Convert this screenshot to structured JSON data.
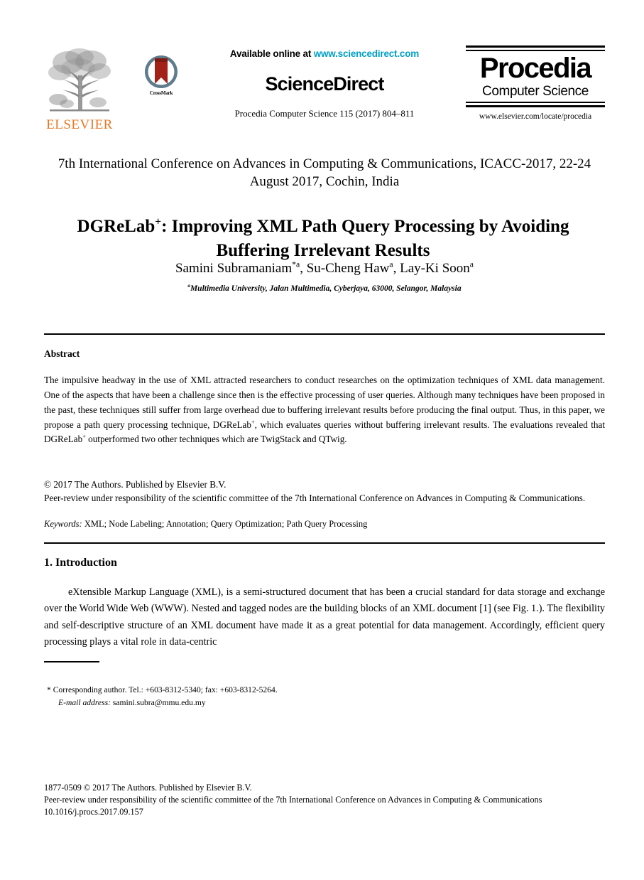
{
  "masthead": {
    "elsevier": {
      "wordmark": "ELSEVIER",
      "logo_icon": "elsevier-tree-icon",
      "wordmark_color": "#E87722"
    },
    "crossmark": {
      "label": "CrossMark",
      "icon": "crossmark-badge-icon",
      "ring_color": "#5E7C8C",
      "ribbon_color": "#A32217"
    },
    "sciencedirect": {
      "available_prefix": "Available online at ",
      "url": "www.sciencedirect.com",
      "url_color": "#009FC7",
      "wordmark": "ScienceDirect",
      "series_line": "Procedia Computer Science 115 (2017) 804–811"
    },
    "procedia": {
      "name": "Procedia",
      "subtitle": "Computer Science",
      "url": "www.elsevier.com/locate/procedia"
    }
  },
  "conference": "7th International Conference on Advances in Computing & Communications, ICACC-2017, 22-24 August 2017, Cochin, India",
  "title": {
    "part1": "DGReLab",
    "superscript": "+",
    "part2": ": Improving XML Path Query Processing by Avoiding Buffering Irrelevant Results"
  },
  "authors": {
    "author1_name": "Samini Subramaniam",
    "author1_marks": "*a",
    "author2_name": "Su-Cheng Haw",
    "author2_marks": "a",
    "author3_name": "Lay-Ki Soon",
    "author3_marks": "a",
    "separator": ", "
  },
  "affiliation": {
    "mark": "a",
    "text": "Multimedia University, Jalan Multimedia, Cyberjaya, 63000, Selangor, Malaysia"
  },
  "abstract": {
    "heading": "Abstract",
    "paragraph_before_sup": "The impulsive headway in the use of XML attracted researchers to conduct researches on the optimization techniques of XML data management. One of the aspects that have been a challenge since then is the effective processing of user queries. Although many techniques have been proposed in the past, these techniques still suffer from large overhead due to buffering irrelevant results before producing the final output.  Thus, in this paper, we propose a path query processing technique, DGReLab",
    "sup1": "+",
    "paragraph_mid": ", which evaluates queries without buffering irrelevant results. The evaluations revealed that DGReLab",
    "sup2": "+",
    "paragraph_end": " outperformed two other techniques which are TwigStack and QTwig.",
    "copyright_line": "© 2017 The Authors. Published by Elsevier B.V.",
    "peer_review_line": "Peer-review under responsibility of the scientific committee of the 7th International Conference on Advances in Computing & Communications."
  },
  "keywords": {
    "label": "Keywords:",
    "value": " XML; Node Labeling; Annotation; Query Optimization; Path Query Processing"
  },
  "section": {
    "heading": "1. Introduction",
    "body": "eXtensible Markup Language (XML), is a semi-structured document that has been a crucial standard for data storage and exchange over the World Wide Web (WWW).  Nested and tagged nodes are the building blocks of an XML document [1] (see Fig. 1.). The flexibility and self-descriptive structure of an XML document have made it as a great potential for data management.  Accordingly, efficient query processing plays a vital role in data-centric"
  },
  "footnote": {
    "corresponding": "* Corresponding author. Tel.: +603-8312-5340; fax: +603-8312-5264.",
    "email_label": "E-mail address:",
    "email_value": " samini.subra@mmu.edu.my"
  },
  "page_footer": {
    "issn_line": "1877-0509 © 2017 The Authors. Published by Elsevier B.V.",
    "peer_review_line": "Peer-review under responsibility of the scientific committee of the 7th International Conference on Advances in Computing & Communications",
    "doi": "10.1016/j.procs.2017.09.157"
  }
}
